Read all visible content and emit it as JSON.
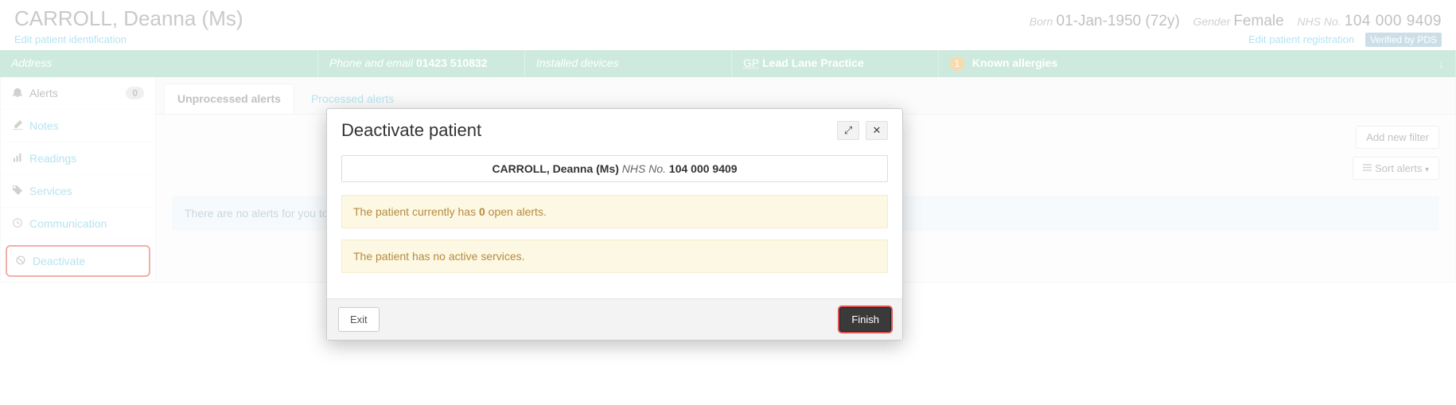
{
  "header": {
    "patient_name": "CARROLL, Deanna (Ms)",
    "born_label": "Born",
    "born_value": "01-Jan-1950 (72y)",
    "gender_label": "Gender",
    "gender_value": "Female",
    "nhs_label": "NHS No.",
    "nhs_value": "104 000 9409",
    "edit_ident": "Edit patient identification",
    "edit_reg": "Edit patient registration",
    "verified": "Verified by PDS"
  },
  "summary": {
    "address_label": "Address",
    "phone_label": "Phone and email",
    "phone_value": "01423 510832",
    "devices_label": "Installed devices",
    "gp_abbr": "GP",
    "gp_value": "Lead Lane Practice",
    "allergy_count": "1",
    "allergy_label": "Known allergies",
    "arrow": "↓"
  },
  "sidebar": {
    "alerts": "Alerts",
    "alerts_count": "0",
    "notes": "Notes",
    "readings": "Readings",
    "services": "Services",
    "communication": "Communication",
    "deactivate": "Deactivate"
  },
  "tabs": {
    "unprocessed": "Unprocessed alerts",
    "processed": "Processed alerts"
  },
  "tools": {
    "add_filter": "Add new filter",
    "sort": "Sort alerts"
  },
  "main": {
    "no_alerts": "There are no alerts for you to v"
  },
  "modal": {
    "title": "Deactivate patient",
    "patient_name": "CARROLL, Deanna (Ms)",
    "nhs_label": "NHS No.",
    "nhs_value": "104 000 9409",
    "warn1_pre": "The patient currently has ",
    "warn1_bold": "0",
    "warn1_post": " open alerts.",
    "warn2": "The patient has no active services.",
    "exit": "Exit",
    "finish": "Finish"
  },
  "icons": {
    "bell": "bell-icon",
    "edit": "edit-icon",
    "bars": "bars-icon",
    "tag": "tag-icon",
    "clock": "clock-icon",
    "ban": "ban-icon",
    "list": "list-icon",
    "caret": "caret-down-icon",
    "expand": "expand-icon",
    "close": "close-icon"
  }
}
